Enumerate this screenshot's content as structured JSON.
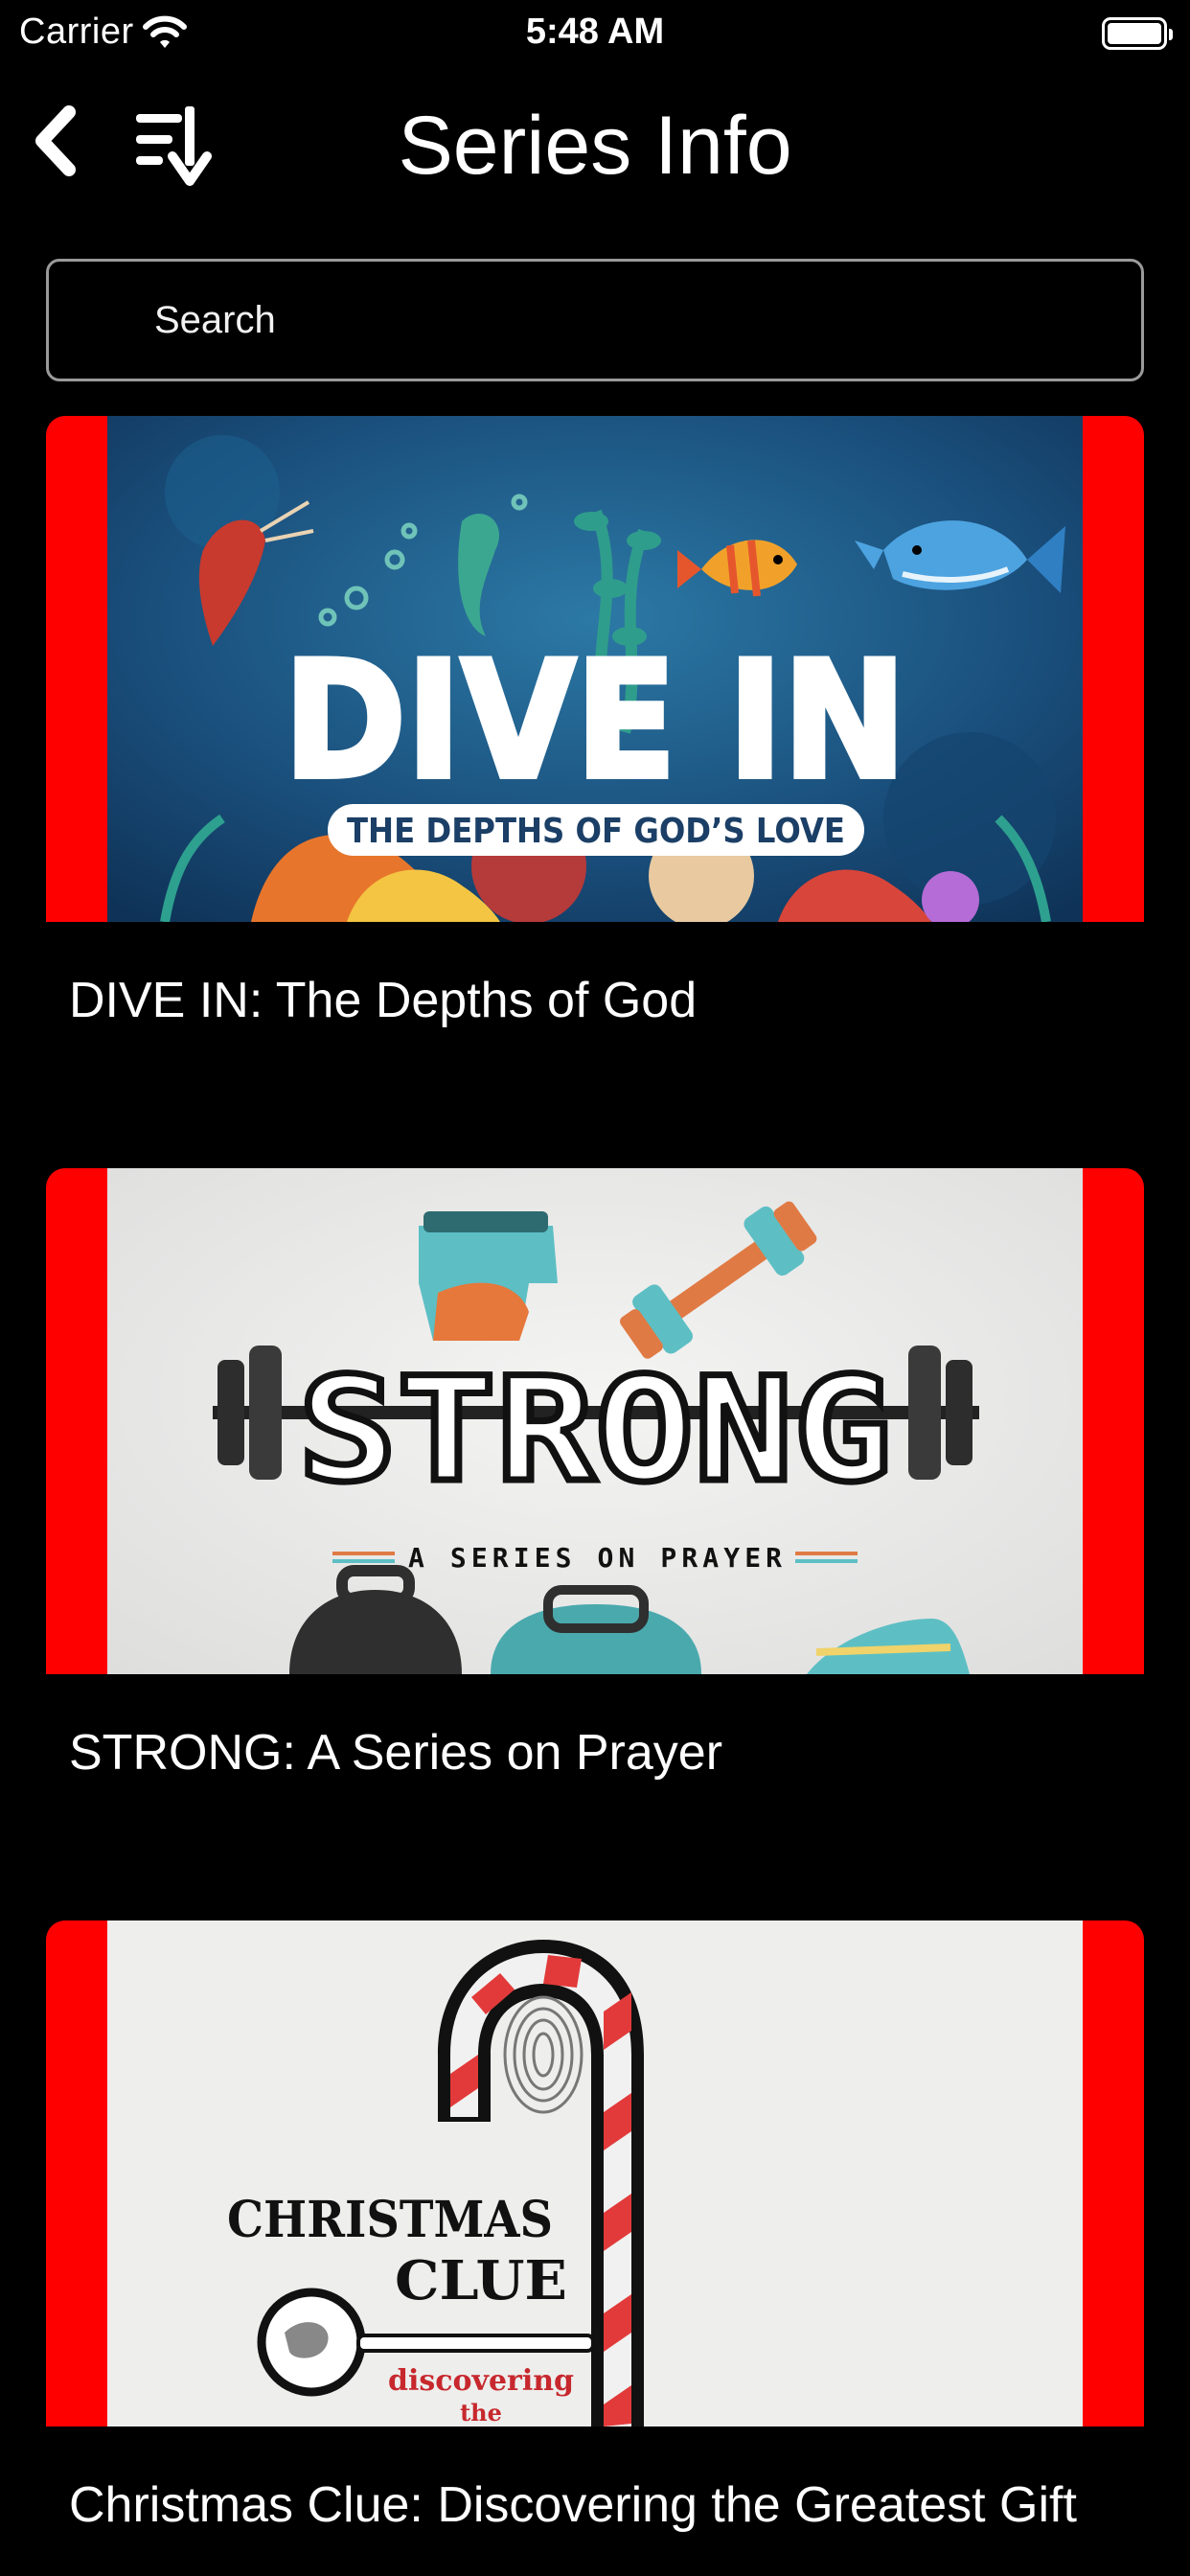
{
  "status_bar": {
    "carrier": "Carrier",
    "time": "5:48 AM"
  },
  "nav": {
    "title": "Series Info"
  },
  "search": {
    "placeholder": "Search"
  },
  "series": [
    {
      "title": "DIVE IN: The Depths of God",
      "art_heading": "DIVE IN",
      "art_subtitle": "THE DEPTHS OF GOD’S LOVE"
    },
    {
      "title": "STRONG: A Series on Prayer",
      "art_heading": "STRONG",
      "art_subtitle": "A SERIES ON PRAYER"
    },
    {
      "title": "Christmas Clue: Discovering the Greatest Gift",
      "art_heading_line1": "CHRISTMAS",
      "art_heading_line2": "CLUE",
      "art_subtitle": "discovering",
      "art_subtitle2": "the"
    }
  ],
  "colors": {
    "accent_red": "#ff0000",
    "background": "#000000"
  }
}
